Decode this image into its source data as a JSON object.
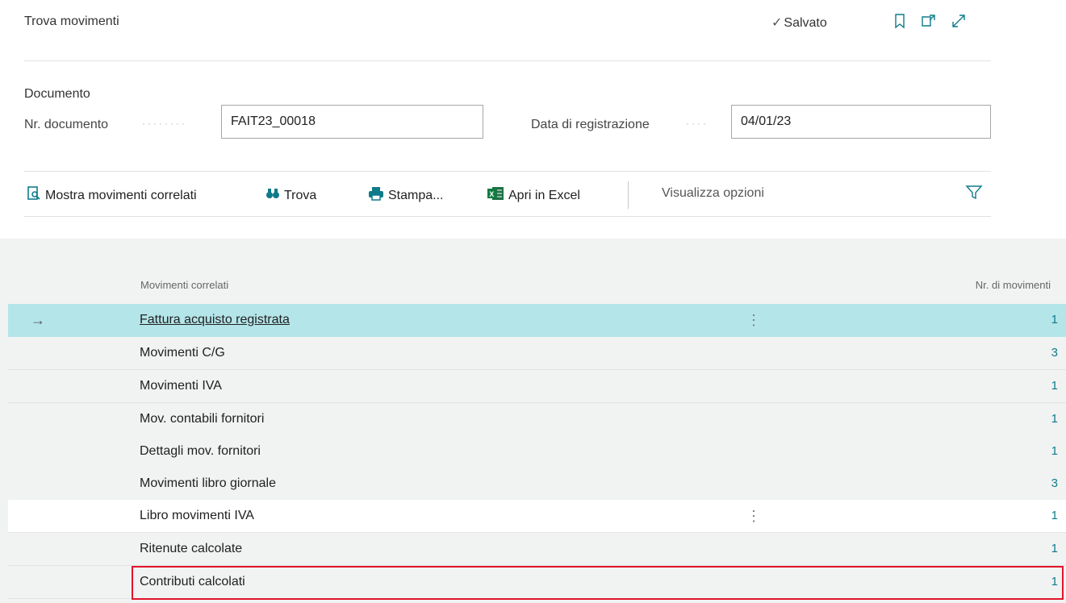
{
  "header": {
    "title": "Trova movimenti",
    "saved_label": "Salvato",
    "icons": [
      "bookmark-icon",
      "open-new-window-icon",
      "expand-icon"
    ]
  },
  "document": {
    "section_title": "Documento",
    "doc_no_label": "Nr. documento",
    "doc_no_value": "FAIT23_00018",
    "posting_date_label": "Data di registrazione",
    "posting_date_value": "04/01/23"
  },
  "actions": {
    "show_related": "Mostra movimenti correlati",
    "find": "Trova",
    "print": "Stampa...",
    "open_excel": "Apri in Excel",
    "view_options": "Visualizza opzioni"
  },
  "table": {
    "col_related": "Movimenti correlati",
    "col_count": "Nr. di movimenti",
    "rows": [
      {
        "name": "Fattura acquisto registrata",
        "count": "1"
      },
      {
        "name": "Movimenti C/G",
        "count": "3"
      },
      {
        "name": "Movimenti IVA",
        "count": "1"
      },
      {
        "name": "Mov. contabili fornitori",
        "count": "1"
      },
      {
        "name": "Dettagli mov. fornitori",
        "count": "1"
      },
      {
        "name": "Movimenti libro giornale",
        "count": "3"
      },
      {
        "name": "Libro movimenti IVA",
        "count": "1"
      },
      {
        "name": "Ritenute calcolate",
        "count": "1"
      },
      {
        "name": "Contributi calcolati",
        "count": "1"
      }
    ]
  },
  "colors": {
    "accent": "#0f7b8a",
    "selected_row": "#b4e5e9",
    "highlight_border": "#e0142a"
  }
}
